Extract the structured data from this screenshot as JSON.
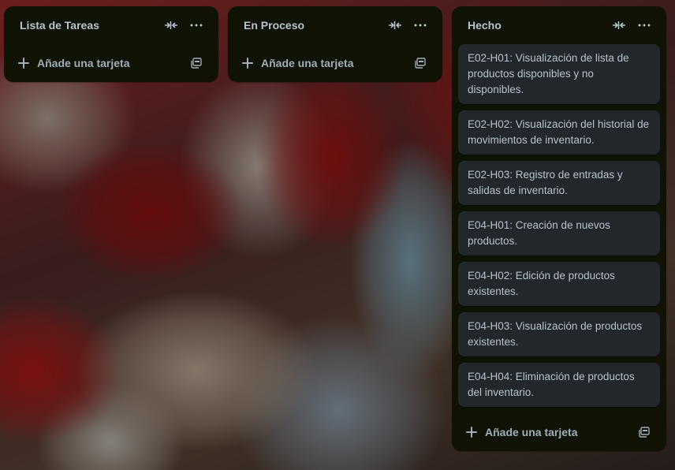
{
  "board": {
    "lists": [
      {
        "title": "Lista de Tareas",
        "add_card_label": "Añade una tarjeta",
        "cards": []
      },
      {
        "title": "En Proceso",
        "add_card_label": "Añade una tarjeta",
        "cards": []
      },
      {
        "title": "Hecho",
        "add_card_label": "Añade una tarjeta",
        "cards": [
          "E02-H01: Visualización de lista de productos disponibles y no disponibles.",
          "E02-H02: Visualización del historial de movimientos de inventario.",
          "E02-H03: Registro de entradas y salidas de inventario.",
          "E04-H01: Creación de nuevos productos.",
          "E04-H02: Edición de productos existentes.",
          "E04-H03: Visualización de productos existentes.",
          "E04-H04: Eliminación de productos del inventario."
        ]
      }
    ]
  },
  "icons": {
    "collapse": "collapse-icon",
    "more": "more-icon",
    "add": "plus-icon",
    "template": "card-template-icon"
  },
  "colors": {
    "list_bg": "#101204",
    "card_bg": "#22272b",
    "text": "#b6c2cf"
  }
}
